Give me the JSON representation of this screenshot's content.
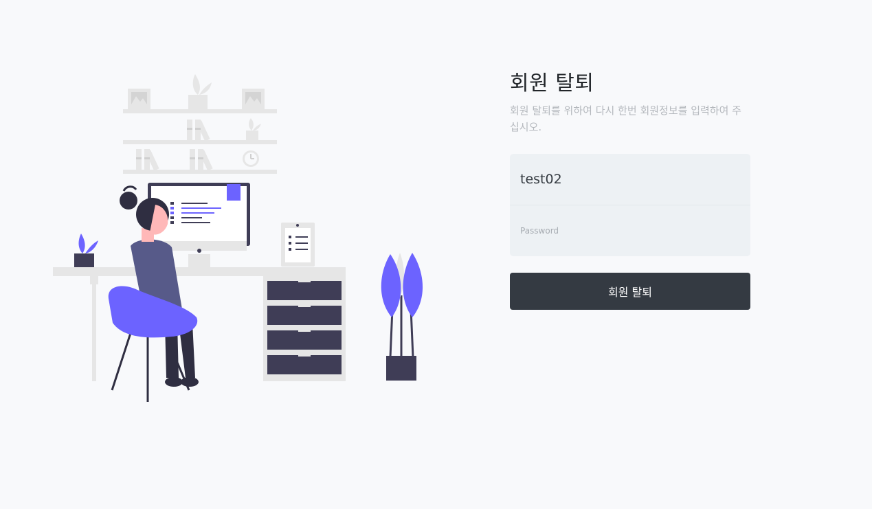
{
  "withdrawal": {
    "title": "회원 탈퇴",
    "subtitle": "회원 탈퇴를 위하여 다시 한번 회원정보를 입력하여 주십시오.",
    "username_value": "test02",
    "password_placeholder": "Password",
    "submit_label": "회원 탈퇴"
  },
  "illustration": {
    "icon": "person-at-desk-illustration"
  },
  "colors": {
    "accent": "#6c63ff",
    "dark": "#3f3d56",
    "light_gray": "#e6e6e6",
    "button": "#343a42",
    "input_bg": "#edf1f4"
  }
}
